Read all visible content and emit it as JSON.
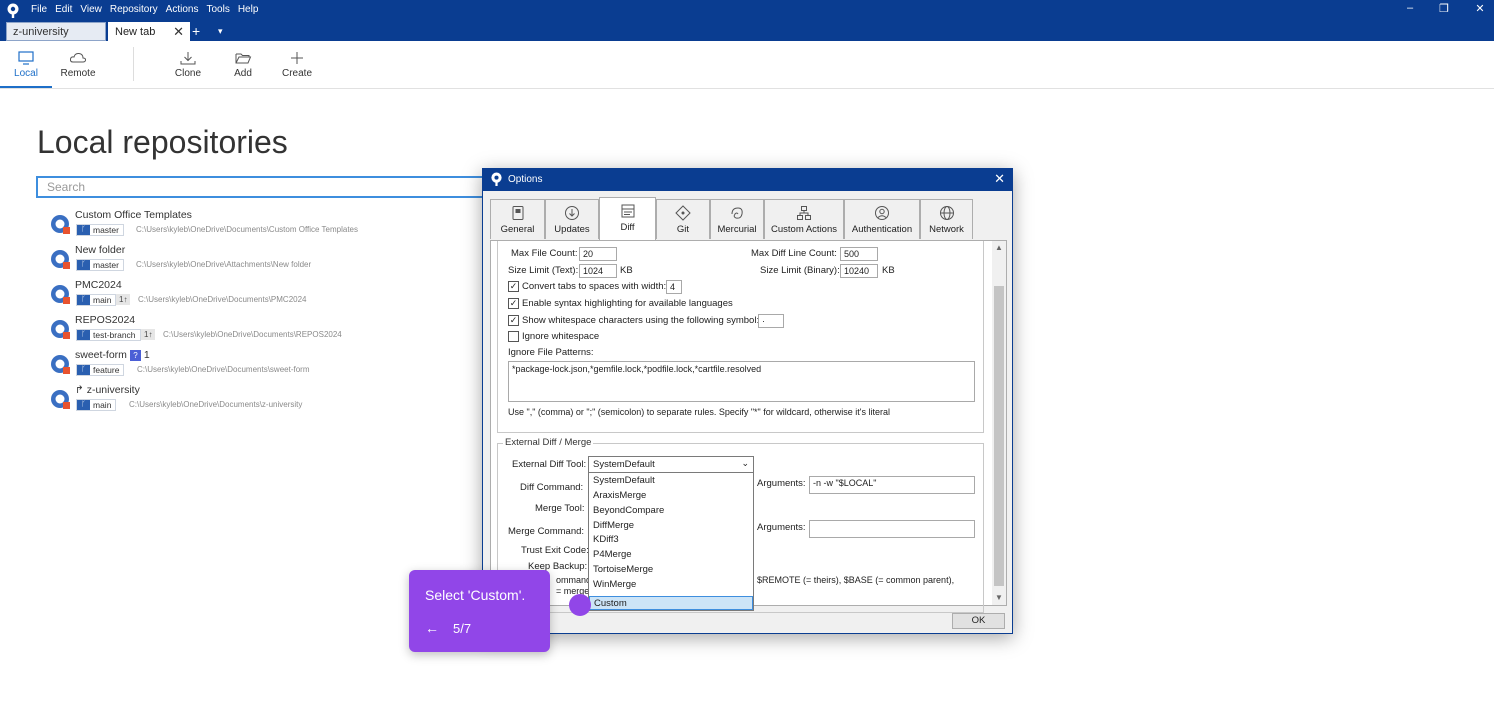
{
  "menu": [
    "File",
    "Edit",
    "View",
    "Repository",
    "Actions",
    "Tools",
    "Help"
  ],
  "tabs": [
    {
      "label": "z-university"
    },
    {
      "label": "New tab"
    }
  ],
  "toolbar": {
    "local": "Local",
    "remote": "Remote",
    "clone": "Clone",
    "add": "Add",
    "create": "Create"
  },
  "main": {
    "title": "Local repositories",
    "search_placeholder": "Search"
  },
  "repos": [
    {
      "name": "Custom Office Templates",
      "branch": "master",
      "ahead": "",
      "path": "C:\\Users\\kyleb\\OneDrive\\Documents\\Custom Office Templates"
    },
    {
      "name": "New folder",
      "branch": "master",
      "ahead": "",
      "path": "C:\\Users\\kyleb\\OneDrive\\Attachments\\New folder"
    },
    {
      "name": "PMC2024",
      "branch": "main",
      "ahead": "1↑",
      "path": "C:\\Users\\kyleb\\OneDrive\\Documents\\PMC2024"
    },
    {
      "name": "REPOS2024",
      "branch": "test-branch",
      "ahead": "1↑",
      "path": "C:\\Users\\kyleb\\OneDrive\\Documents\\REPOS2024"
    },
    {
      "name": "sweet-form",
      "branch": "feature",
      "ahead": "",
      "path": "C:\\Users\\kyleb\\OneDrive\\Documents\\sweet-form",
      "badge": "?",
      "badge_count": "1"
    },
    {
      "name": "z-university",
      "branch": "main",
      "ahead": "",
      "path": "C:\\Users\\kyleb\\OneDrive\\Documents\\z-university"
    }
  ],
  "dialog": {
    "title": "Options",
    "tabs": [
      "General",
      "Updates",
      "Diff",
      "Git",
      "Mercurial",
      "Custom Actions",
      "Authentication",
      "Network"
    ],
    "max_file_count_label": "Max File Count:",
    "max_file_count": "20",
    "max_diff_line_label": "Max Diff Line Count:",
    "max_diff_line": "500",
    "size_limit_text_label": "Size Limit (Text):",
    "size_limit_text": "1024",
    "kb": "KB",
    "size_limit_binary_label": "Size Limit (Binary):",
    "size_limit_binary": "10240",
    "convert_tabs_label": "Convert tabs to spaces with width:",
    "convert_tabs_width": "4",
    "syntax_label": "Enable syntax highlighting for available languages",
    "whitespace_symbol_label": "Show whitespace characters using the following symbol:",
    "whitespace_symbol": "·",
    "ignore_whitespace_label": "Ignore whitespace",
    "ignore_patterns_label": "Ignore File Patterns:",
    "ignore_patterns": "*package-lock.json,*gemfile.lock,*podfile.lock,*cartfile.resolved",
    "rules_hint": "Use \",\" (comma) or \";\" (semicolon) to separate rules. Specify \"*\" for wildcard, otherwise it's literal",
    "ext_group_label": "External Diff / Merge",
    "ext_diff_tool_label": "External Diff Tool:",
    "ext_diff_tool_value": "SystemDefault",
    "diff_command_label": "Diff Command:",
    "arguments_label": "Arguments:",
    "diff_arguments": "-n -w \"$LOCAL\"",
    "merge_tool_label": "Merge Tool:",
    "merge_command_label": "Merge Command:",
    "merge_arguments": "",
    "trust_exit_label": "Trust Exit Code:",
    "keep_backup_label": "Keep Backup:",
    "command_partial": "ommand",
    "merge_partial": "= merge",
    "remote_hint": "$REMOTE (= theirs), $BASE (= common parent),",
    "dropdown_options": [
      "SystemDefault",
      "AraxisMerge",
      "BeyondCompare",
      "DiffMerge",
      "KDiff3",
      "P4Merge",
      "TortoiseMerge",
      "WinMerge",
      "Custom"
    ],
    "ok": "OK"
  },
  "tooltip": {
    "message": "Select 'Custom'.",
    "back": "←",
    "step": "5/7"
  },
  "colors": {
    "titlebar": "#0a3d91",
    "accent": "#1e6fc8",
    "tooltip": "#9146e8"
  }
}
